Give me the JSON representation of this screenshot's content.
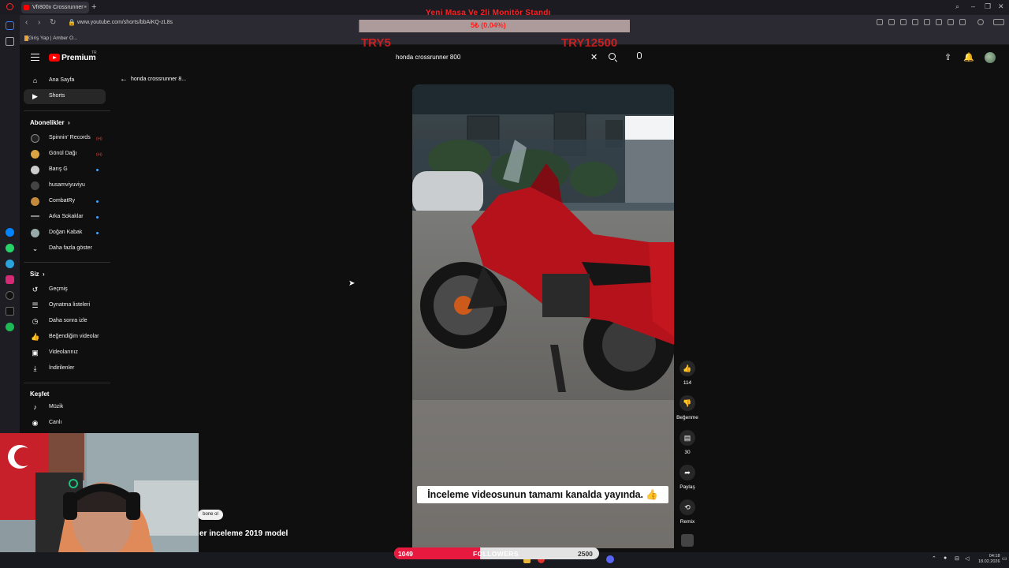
{
  "browser": {
    "tab_title": "Vfr800x Crossrunner -",
    "url": "www.youtube.com/shorts/bbAiKQ-zL8s",
    "bookmark": "Giriş Yap | Amber O...",
    "new_tab_glyph": "+",
    "close_glyph": "×"
  },
  "stream_overlay": {
    "goal_title": "Yeni Masa Ve 2li Monitör Standı",
    "goal_progress": "5₺ (0.04%)",
    "goal_fraction": 0.0004,
    "goal_min": "TRY5",
    "goal_max": "TRY12500",
    "followers_current": "1049",
    "followers_label": "FOLLOWERS",
    "followers_goal": "2500",
    "followers_fraction": 0.42
  },
  "youtube": {
    "logo_text": "Premium",
    "logo_region": "TR",
    "search_value": "honda crossrunner 800",
    "back_title": "honda crossrunner 8..."
  },
  "sidebar": {
    "main": [
      {
        "label": "Ana Sayfa",
        "icon": "home-icon"
      },
      {
        "label": "Shorts",
        "icon": "shorts-icon",
        "active": true
      }
    ],
    "subs_heading": "Abonelikler",
    "subscriptions": [
      {
        "label": "Spinnin' Records",
        "status": "live"
      },
      {
        "label": "Gönül Dağı",
        "status": "live"
      },
      {
        "label": "Barış G",
        "status": "new"
      },
      {
        "label": "husamviyuviyu",
        "status": "none"
      },
      {
        "label": "CombatRy",
        "status": "new"
      },
      {
        "label": "Arka Sokaklar",
        "status": "new"
      },
      {
        "label": "Doğan Kabak",
        "status": "new"
      },
      {
        "label": "Daha fazla göster",
        "status": "none"
      }
    ],
    "you_heading": "Siz",
    "you_items": [
      {
        "label": "Geçmiş",
        "icon": "history-icon"
      },
      {
        "label": "Oynatma listeleri",
        "icon": "playlist-icon"
      },
      {
        "label": "Daha sonra izle",
        "icon": "watch-later-icon"
      },
      {
        "label": "Beğendiğim videolar",
        "icon": "liked-icon"
      },
      {
        "label": "Videolarınız",
        "icon": "your-videos-icon"
      },
      {
        "label": "İndirilenler",
        "icon": "download-icon"
      }
    ],
    "explore_heading": "Keşfet",
    "explore_items": [
      {
        "label": "Müzik",
        "icon": "music-icon"
      },
      {
        "label": "Canlı",
        "icon": "live-icon"
      }
    ]
  },
  "short": {
    "caption": "İnceleme videosunun tamamı kanalda yayında. 👍",
    "like_count": "114",
    "dislike_label": "Beğenme",
    "comment_count": "30",
    "share_label": "Paylaş",
    "remix_label": "Remix",
    "subscribe_label": "bone ol",
    "bottom_title": "er inceleme 2019 model"
  },
  "clock": {
    "time": "04:18",
    "date": "18.02.2026"
  }
}
